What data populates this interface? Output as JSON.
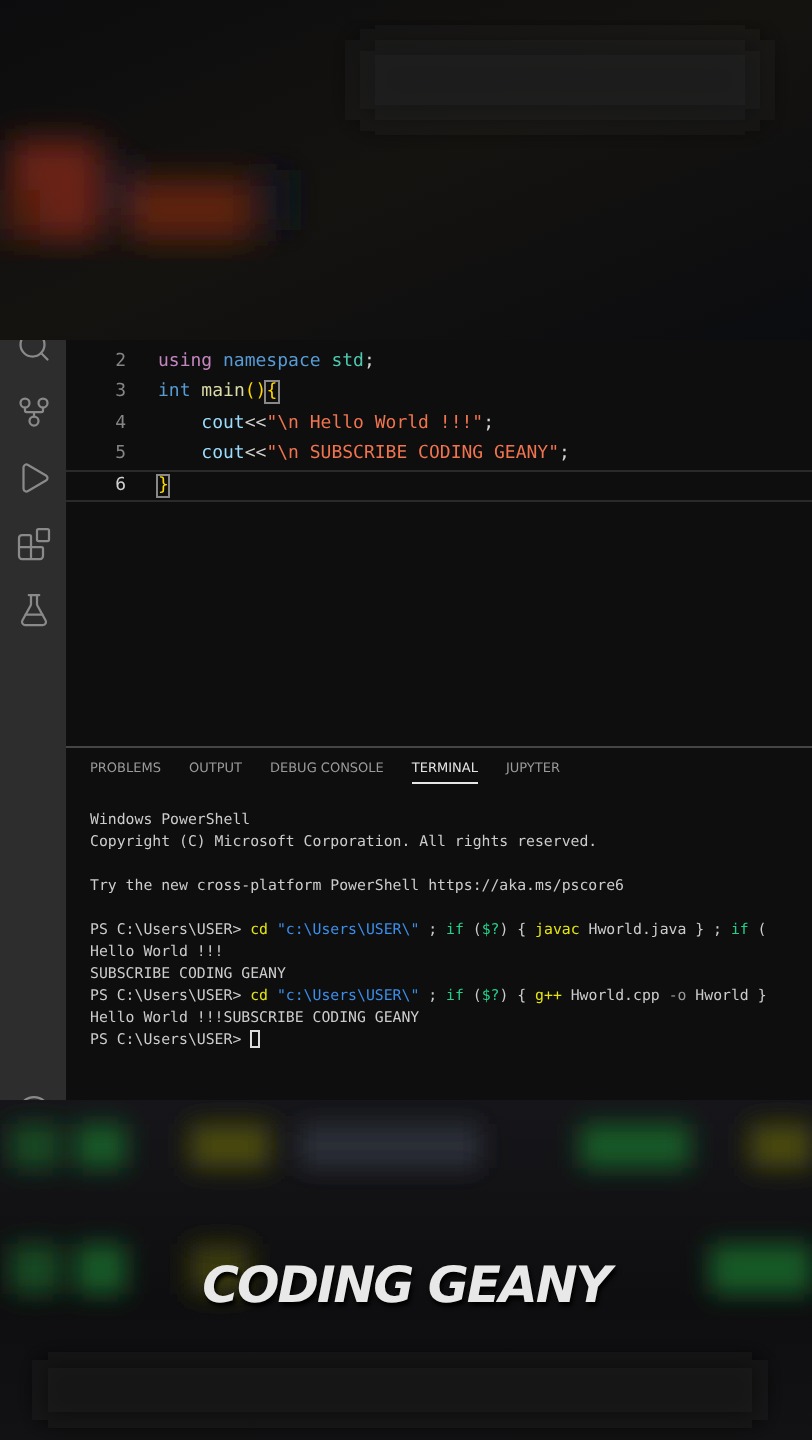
{
  "editor": {
    "lines": [
      {
        "number": "2",
        "current": false,
        "tokens": [
          {
            "text": "using",
            "kind": "keyword"
          },
          {
            "text": " namespace",
            "kind": "storage"
          },
          {
            "text": " std",
            "kind": "type"
          },
          {
            "text": ";",
            "kind": "plain"
          }
        ]
      },
      {
        "number": "3",
        "current": false,
        "tokens": [
          {
            "text": "int",
            "kind": "storage"
          },
          {
            "text": " main",
            "kind": "function"
          },
          {
            "text": "()",
            "kind": "paren"
          },
          {
            "text": "{",
            "kind": "brace-match"
          }
        ]
      },
      {
        "number": "4",
        "current": false,
        "tokens": [
          {
            "text": "    cout",
            "kind": "variable"
          },
          {
            "text": "<<",
            "kind": "plain"
          },
          {
            "text": "\"\\n Hello World !!!\"",
            "kind": "string"
          },
          {
            "text": ";",
            "kind": "plain"
          }
        ]
      },
      {
        "number": "5",
        "current": false,
        "tokens": [
          {
            "text": "    cout",
            "kind": "variable"
          },
          {
            "text": "<<",
            "kind": "plain"
          },
          {
            "text": "\"\\n SUBSCRIBE CODING GEANY\"",
            "kind": "string"
          },
          {
            "text": ";",
            "kind": "plain"
          }
        ]
      },
      {
        "number": "6",
        "current": true,
        "tokens": [
          {
            "text": "}",
            "kind": "brace-match"
          }
        ]
      }
    ]
  },
  "panel": {
    "tabs": [
      {
        "label": "PROBLEMS",
        "selected": false
      },
      {
        "label": "OUTPUT",
        "selected": false
      },
      {
        "label": "DEBUG CONSOLE",
        "selected": false
      },
      {
        "label": "TERMINAL",
        "selected": true
      },
      {
        "label": "JUPYTER",
        "selected": false
      }
    ],
    "terminal": [
      {
        "gap_before": false,
        "tokens": [
          {
            "text": "Windows PowerShell",
            "kind": "plain"
          }
        ]
      },
      {
        "gap_before": false,
        "tokens": [
          {
            "text": "Copyright (C) Microsoft Corporation. All rights reserved.",
            "kind": "plain"
          }
        ]
      },
      {
        "gap_before": true,
        "tokens": [
          {
            "text": "Try the new cross-platform PowerShell https://aka.ms/pscore6",
            "kind": "plain"
          }
        ]
      },
      {
        "gap_before": true,
        "tokens": [
          {
            "text": "PS C:\\Users\\USER> ",
            "kind": "plain"
          },
          {
            "text": "cd",
            "kind": "command"
          },
          {
            "text": " \"c:\\Users\\USER\\\"",
            "kind": "string"
          },
          {
            "text": " ; ",
            "kind": "plain"
          },
          {
            "text": "if",
            "kind": "keyword"
          },
          {
            "text": " (",
            "kind": "plain"
          },
          {
            "text": "$?",
            "kind": "keyword"
          },
          {
            "text": ") { ",
            "kind": "plain"
          },
          {
            "text": "javac",
            "kind": "command"
          },
          {
            "text": " Hworld.java } ; ",
            "kind": "plain"
          },
          {
            "text": "if",
            "kind": "keyword"
          },
          {
            "text": " (",
            "kind": "plain"
          }
        ]
      },
      {
        "gap_before": false,
        "tokens": [
          {
            "text": "Hello World !!!",
            "kind": "plain"
          }
        ]
      },
      {
        "gap_before": false,
        "tokens": [
          {
            "text": "SUBSCRIBE CODING GEANY",
            "kind": "plain"
          }
        ]
      },
      {
        "gap_before": false,
        "tokens": [
          {
            "text": "PS C:\\Users\\USER> ",
            "kind": "plain"
          },
          {
            "text": "cd",
            "kind": "command"
          },
          {
            "text": " \"c:\\Users\\USER\\\"",
            "kind": "string"
          },
          {
            "text": " ; ",
            "kind": "plain"
          },
          {
            "text": "if",
            "kind": "keyword"
          },
          {
            "text": " (",
            "kind": "plain"
          },
          {
            "text": "$?",
            "kind": "keyword"
          },
          {
            "text": ") { ",
            "kind": "plain"
          },
          {
            "text": "g++",
            "kind": "command"
          },
          {
            "text": " Hworld.cpp ",
            "kind": "plain"
          },
          {
            "text": "-o",
            "kind": "option"
          },
          {
            "text": " Hworld }",
            "kind": "plain"
          }
        ]
      },
      {
        "gap_before": false,
        "tokens": [
          {
            "text": "Hello World !!!SUBSCRIBE CODING GEANY",
            "kind": "plain"
          }
        ]
      },
      {
        "gap_before": false,
        "cursor": true,
        "tokens": [
          {
            "text": "PS C:\\Users\\USER> ",
            "kind": "plain"
          }
        ]
      }
    ]
  },
  "caption": "CODING GEANY"
}
